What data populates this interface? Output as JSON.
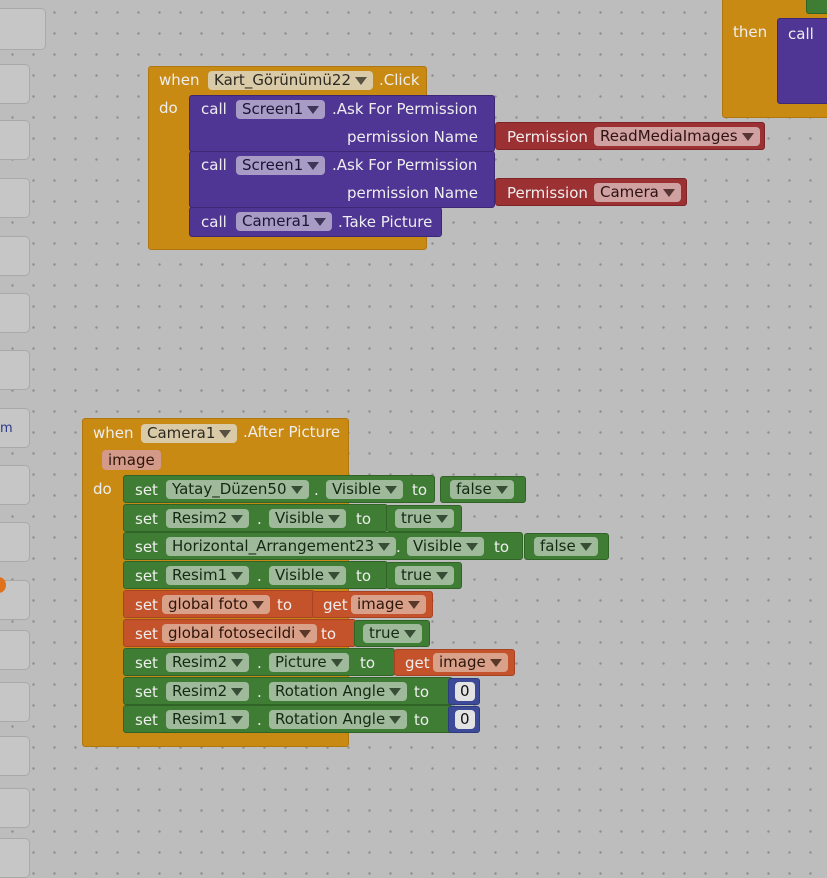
{
  "palette": {
    "partial_label": "m"
  },
  "top_right": {
    "then_label": "then",
    "call_label": "call"
  },
  "click_event": {
    "when": "when",
    "component": "Kart_Görünümü22",
    "event": ".Click",
    "do": "do",
    "calls": [
      {
        "call": "call",
        "component": "Screen1",
        "method": ".Ask For Permission",
        "arg_label": "permission Name",
        "perm_label": "Permission",
        "perm_value": "ReadMediaImages"
      },
      {
        "call": "call",
        "component": "Screen1",
        "method": ".Ask For Permission",
        "arg_label": "permission Name",
        "perm_label": "Permission",
        "perm_value": "Camera"
      },
      {
        "call": "call",
        "component": "Camera1",
        "method": ".Take Picture"
      }
    ]
  },
  "picture_event": {
    "when": "when",
    "component": "Camera1",
    "event": ".After Picture",
    "param": "image",
    "do": "do",
    "sets": [
      {
        "set": "set",
        "component": "Yatay_Düzen50",
        "dot": ".",
        "prop": "Visible",
        "to": "to",
        "value": "false"
      },
      {
        "set": "set",
        "component": "Resim2",
        "dot": ".",
        "prop": "Visible",
        "to": "to",
        "value": "true"
      },
      {
        "set": "set",
        "component": "Horizontal_Arrangement23",
        "dot": ".",
        "prop": "Visible",
        "to": "to",
        "value": "false"
      },
      {
        "set": "set",
        "component": "Resim1",
        "dot": ".",
        "prop": "Visible",
        "to": "to",
        "value": "true"
      },
      {
        "set": "set",
        "var": "global foto",
        "to": "to",
        "get": "get",
        "get_var": "image"
      },
      {
        "set": "set",
        "var": "global fotosecildi",
        "to": "to",
        "value": "true"
      },
      {
        "set": "set",
        "component": "Resim2",
        "dot": ".",
        "prop": "Picture",
        "to": "to",
        "get": "get",
        "get_var": "image"
      },
      {
        "set": "set",
        "component": "Resim2",
        "dot": ".",
        "prop": "Rotation Angle",
        "to": "to",
        "value": "0"
      },
      {
        "set": "set",
        "component": "Resim1",
        "dot": ".",
        "prop": "Rotation Angle",
        "to": "to",
        "value": "0"
      }
    ]
  }
}
